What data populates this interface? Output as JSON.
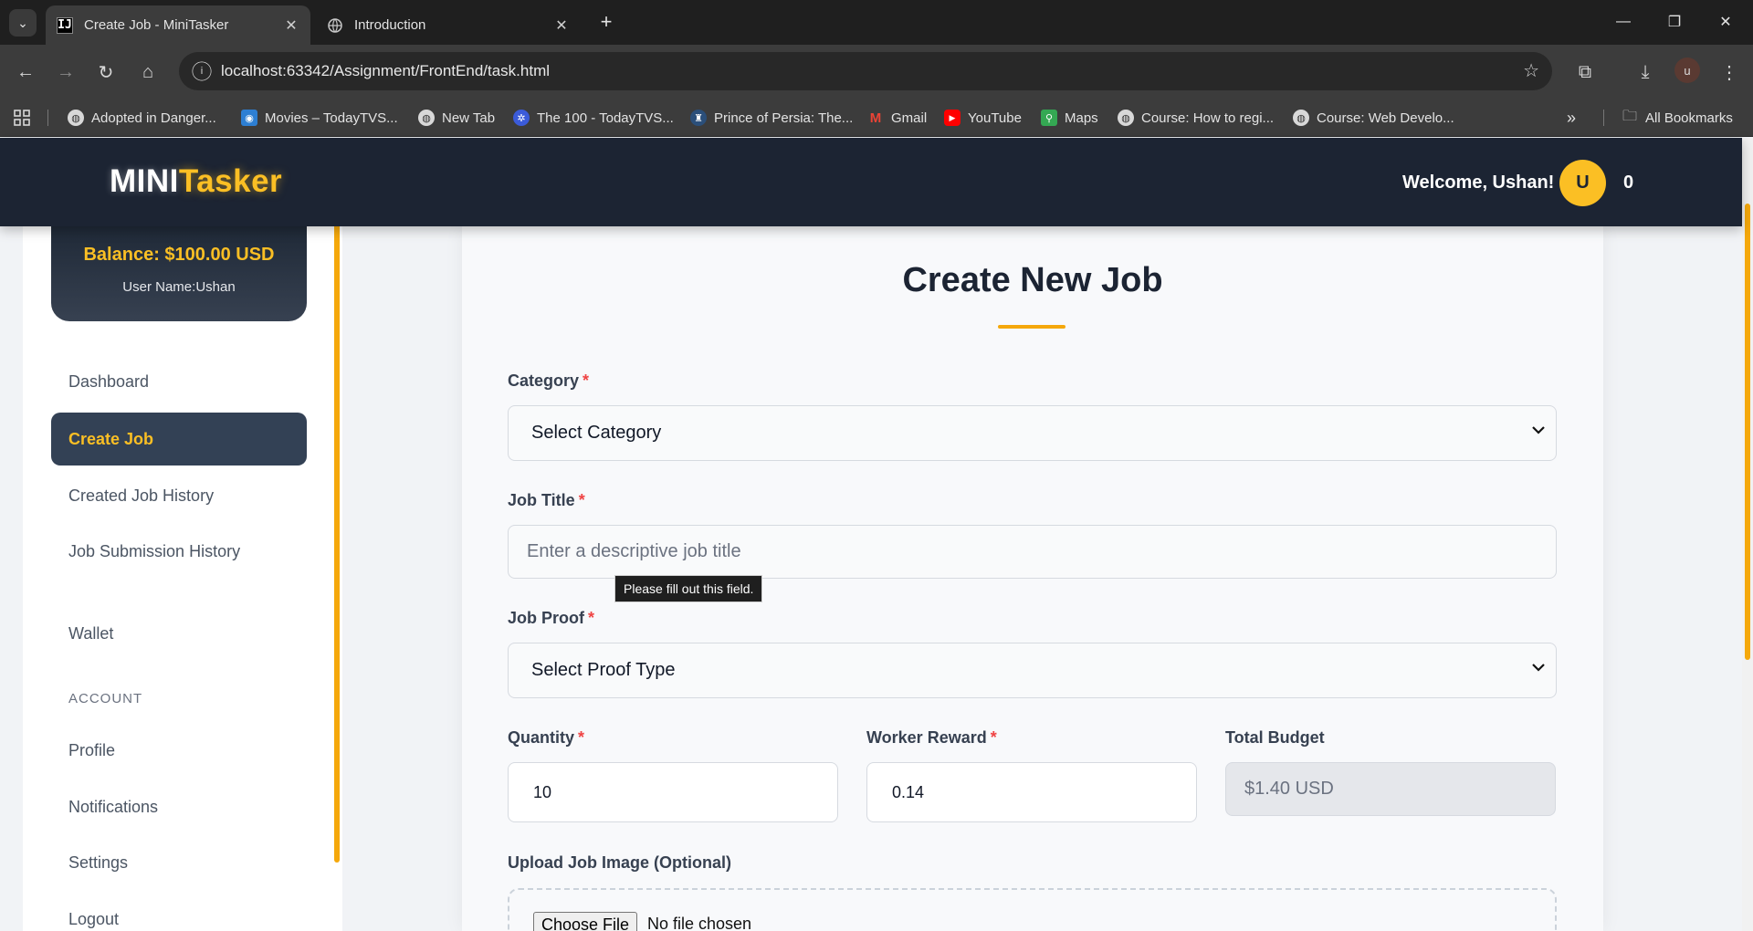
{
  "browser": {
    "tabs": [
      {
        "title": "Create Job - MiniTasker",
        "icon": "intellij-icon"
      },
      {
        "title": "Introduction",
        "icon": "globe-icon"
      }
    ],
    "url": "localhost:63342/Assignment/FrontEnd/task.html",
    "profile_initial": "u",
    "bookmarks": [
      {
        "label": "Adopted in Danger...",
        "icon": "globe-icon"
      },
      {
        "label": "Movies – TodayTVS...",
        "icon": "todaytvs-icon"
      },
      {
        "label": "New Tab",
        "icon": "globe-icon"
      },
      {
        "label": "The 100 - TodayTVS...",
        "icon": "todaytvs-icon"
      },
      {
        "label": "Prince of Persia: The...",
        "icon": "game-icon"
      },
      {
        "label": "Gmail",
        "icon": "gmail-icon"
      },
      {
        "label": "YouTube",
        "icon": "youtube-icon"
      },
      {
        "label": "Maps",
        "icon": "maps-icon"
      },
      {
        "label": "Course: How to regi...",
        "icon": "globe-icon"
      },
      {
        "label": "Course: Web Develo...",
        "icon": "globe-icon"
      }
    ],
    "all_bookmarks_label": "All Bookmarks"
  },
  "header": {
    "logo_part1": "MINI",
    "logo_part2": "Tasker",
    "welcome": "Welcome, Ushan!",
    "avatar_initial": "U",
    "notification_count": "0"
  },
  "sidebar": {
    "balance": "Balance: $100.00 USD",
    "username": "User Name:Ushan",
    "items": [
      {
        "label": "Dashboard"
      },
      {
        "label": "Create Job"
      },
      {
        "label": "Created Job History"
      },
      {
        "label": "Job Submission History"
      },
      {
        "label": "Wallet"
      }
    ],
    "account_section": "ACCOUNT",
    "account_items": [
      {
        "label": "Profile"
      },
      {
        "label": "Notifications"
      },
      {
        "label": "Settings"
      },
      {
        "label": "Logout"
      }
    ]
  },
  "form": {
    "title": "Create New Job",
    "category_label": "Category",
    "category_value": "Select Category",
    "job_title_label": "Job Title",
    "job_title_placeholder": "Enter a descriptive job title",
    "validation_tooltip": "Please fill out this field.",
    "job_proof_label": "Job Proof",
    "job_proof_value": "Select Proof Type",
    "quantity_label": "Quantity",
    "quantity_value": "10",
    "worker_reward_label": "Worker Reward",
    "worker_reward_value": "0.14",
    "total_budget_label": "Total Budget",
    "total_budget_value": "$1.40 USD",
    "upload_label": "Upload Job Image (Optional)",
    "choose_file_label": "Choose File",
    "file_status": "No file chosen",
    "required_mark": "*"
  },
  "colors": {
    "accent": "#fbbf24",
    "header_bg": "#1c2433",
    "required": "#ef4444"
  }
}
